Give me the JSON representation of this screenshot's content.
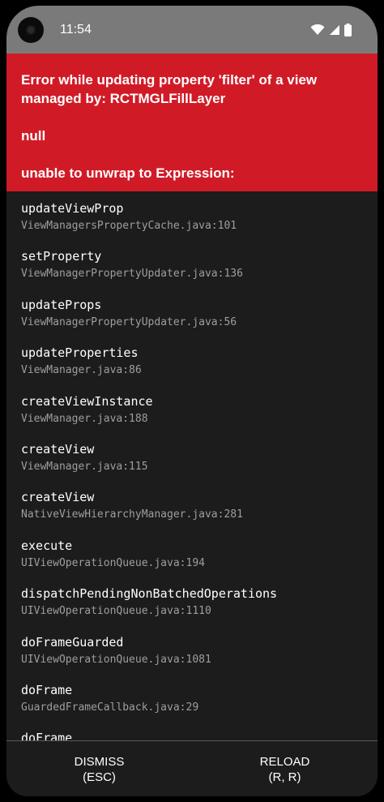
{
  "status_bar": {
    "time": "11:54",
    "icons": [
      "camera-cutout",
      "wifi-icon",
      "cellular-signal-icon",
      "battery-icon"
    ]
  },
  "error": {
    "title": "Error while updating property 'filter' of a view managed by: RCTMGLFillLayer",
    "value": "null",
    "detail": "unable to unwrap to Expression:"
  },
  "stack": [
    {
      "method": "updateViewProp",
      "file": "ViewManagersPropertyCache.java:101"
    },
    {
      "method": "setProperty",
      "file": "ViewManagerPropertyUpdater.java:136"
    },
    {
      "method": "updateProps",
      "file": "ViewManagerPropertyUpdater.java:56"
    },
    {
      "method": "updateProperties",
      "file": "ViewManager.java:86"
    },
    {
      "method": "createViewInstance",
      "file": "ViewManager.java:188"
    },
    {
      "method": "createView",
      "file": "ViewManager.java:115"
    },
    {
      "method": "createView",
      "file": "NativeViewHierarchyManager.java:281"
    },
    {
      "method": "execute",
      "file": "UIViewOperationQueue.java:194"
    },
    {
      "method": "dispatchPendingNonBatchedOperations",
      "file": "UIViewOperationQueue.java:1110"
    },
    {
      "method": "doFrameGuarded",
      "file": "UIViewOperationQueue.java:1081"
    },
    {
      "method": "doFrame",
      "file": "GuardedFrameCallback.java:29"
    },
    {
      "method": "doFrame",
      "file": ""
    }
  ],
  "buttons": {
    "dismiss": {
      "label": "DISMISS",
      "shortcut": "(ESC)"
    },
    "reload": {
      "label": "RELOAD",
      "shortcut": "(R, R)"
    }
  },
  "colors": {
    "error_red": "#d01b27",
    "background": "#1c1c1c",
    "status_bar": "#7a7a7a",
    "file_text": "#9e9e9e"
  }
}
